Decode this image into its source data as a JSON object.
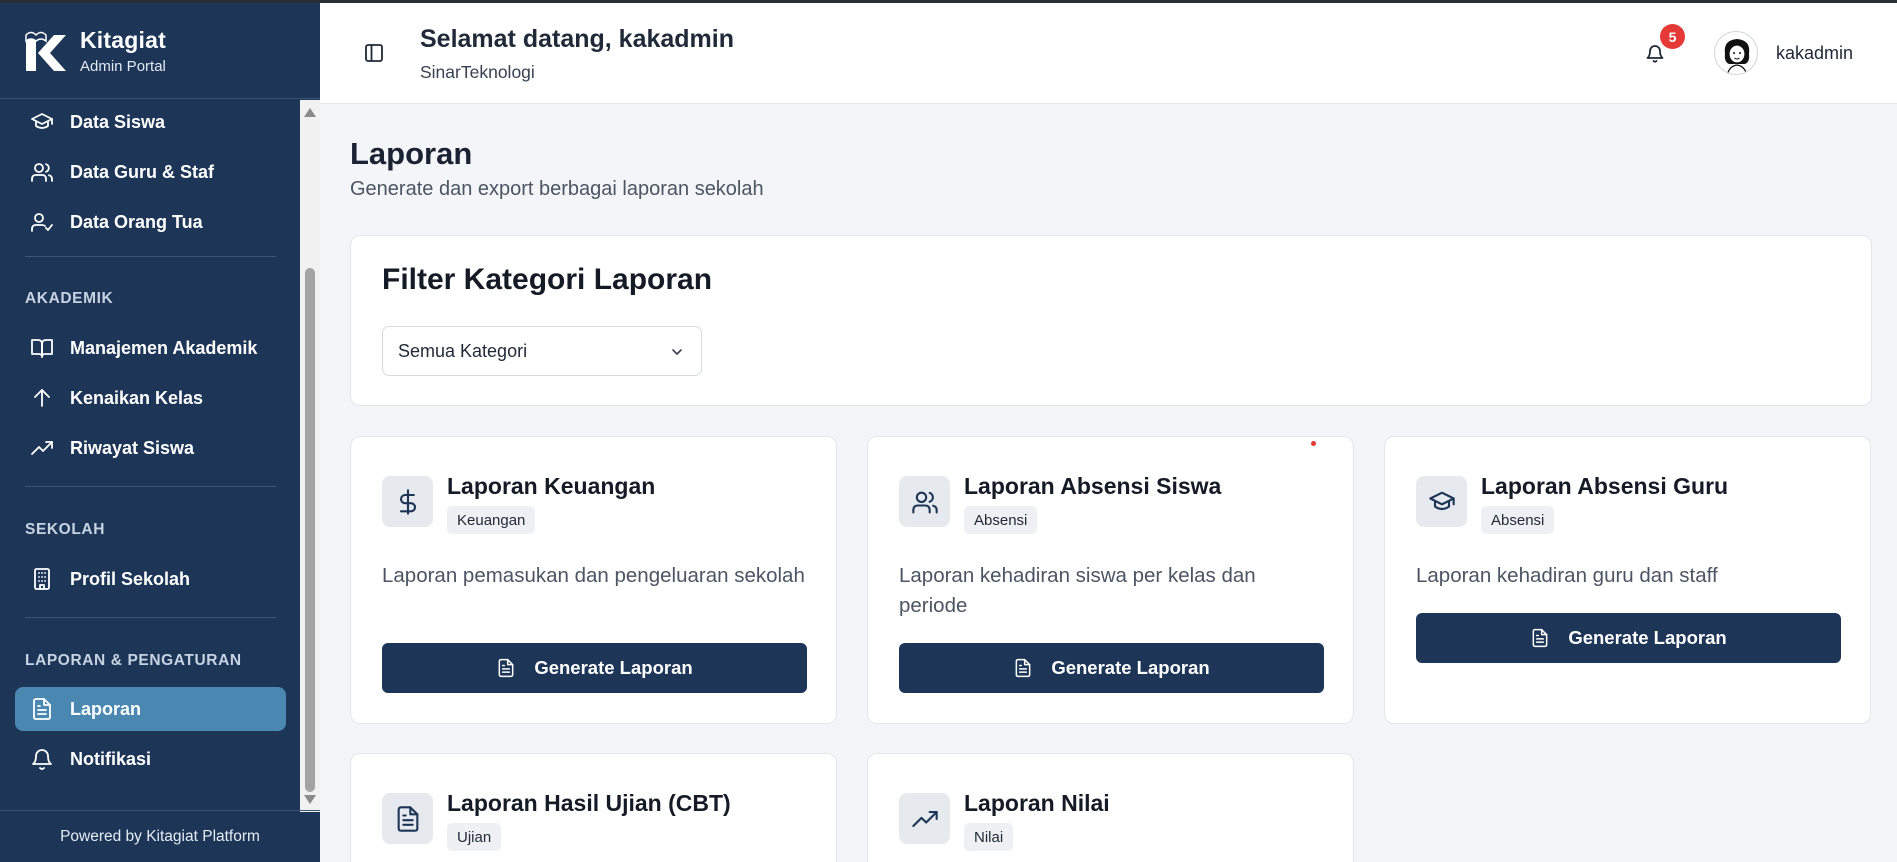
{
  "brand": {
    "name": "Kitagiat",
    "subtitle": "Admin Portal"
  },
  "sidebar": {
    "items": [
      {
        "label": "Data Siswa",
        "icon": "graduation-cap-icon"
      },
      {
        "label": "Data Guru & Staf",
        "icon": "users-icon"
      },
      {
        "label": "Data Orang Tua",
        "icon": "user-check-icon"
      },
      {
        "label": "Manajemen Akademik",
        "icon": "book-open-icon"
      },
      {
        "label": "Kenaikan Kelas",
        "icon": "arrow-up-icon"
      },
      {
        "label": "Riwayat Siswa",
        "icon": "trending-up-icon"
      },
      {
        "label": "Profil Sekolah",
        "icon": "building-icon"
      },
      {
        "label": "Laporan",
        "icon": "file-text-icon",
        "active": true
      },
      {
        "label": "Notifikasi",
        "icon": "bell-icon"
      }
    ],
    "sections": {
      "akademik": "AKADEMIK",
      "sekolah": "SEKOLAH",
      "laporan": "LAPORAN & PENGATURAN"
    },
    "powered_by": "Powered by Kitagiat Platform"
  },
  "header": {
    "welcome": "Selamat datang, kakadmin",
    "tenant": "SinarTeknologi",
    "notification_count": "5",
    "username": "kakadmin"
  },
  "page": {
    "title": "Laporan",
    "subtitle": "Generate dan export berbagai laporan sekolah"
  },
  "filter": {
    "title": "Filter Kategori Laporan",
    "selected": "Semua Kategori"
  },
  "reports": [
    {
      "title": "Laporan Keuangan",
      "tag": "Keuangan",
      "desc": "Laporan pemasukan dan pengeluaran sekolah",
      "button": "Generate Laporan",
      "icon": "dollar-icon"
    },
    {
      "title": "Laporan Absensi Siswa",
      "tag": "Absensi",
      "desc": "Laporan kehadiran siswa per kelas dan periode",
      "button": "Generate Laporan",
      "icon": "users-icon"
    },
    {
      "title": "Laporan Absensi Guru",
      "tag": "Absensi",
      "desc": "Laporan kehadiran guru dan staff",
      "button": "Generate Laporan",
      "icon": "graduation-cap-icon"
    },
    {
      "title": "Laporan Hasil Ujian (CBT)",
      "tag": "Ujian",
      "icon": "file-text-icon"
    },
    {
      "title": "Laporan Nilai",
      "tag": "Nilai",
      "icon": "trending-up-icon"
    }
  ],
  "colors": {
    "sidebar_bg": "#1d3557",
    "active_item": "#4a88b2",
    "primary_button": "#1d3557",
    "badge": "#e53935"
  }
}
